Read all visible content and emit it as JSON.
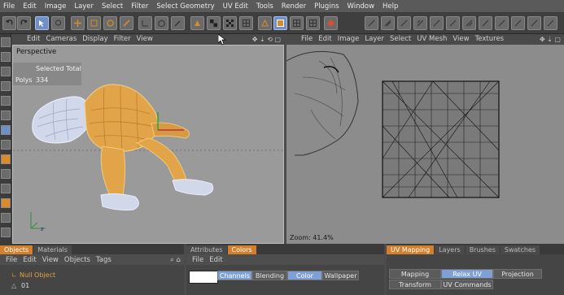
{
  "menubar": [
    "File",
    "Edit",
    "Image",
    "Layer",
    "Select",
    "Filter",
    "Select Geometry",
    "UV Edit",
    "Tools",
    "Render",
    "Plugins",
    "Window",
    "Help"
  ],
  "viewport": {
    "menu": [
      "Edit",
      "Cameras",
      "Display",
      "Filter",
      "View"
    ],
    "label": "Perspective",
    "hud_header": "Selected Total",
    "hud_row_label": "Polys",
    "hud_row_value": "334",
    "axis_z": "z"
  },
  "uv": {
    "menu": [
      "File",
      "Edit",
      "Image",
      "Layer",
      "Select",
      "UV Mesh",
      "View",
      "Textures"
    ],
    "zoom": "Zoom: 41.4%"
  },
  "objects": {
    "tabs": [
      "Objects",
      "Materials"
    ],
    "menu": [
      "File",
      "Edit",
      "View",
      "Objects",
      "Tags"
    ],
    "items": [
      {
        "name": "Null Object"
      },
      {
        "name": "01"
      }
    ]
  },
  "attributes": {
    "tabs": [
      "Attributes",
      "Colors"
    ],
    "menu": [
      "File",
      "Edit"
    ],
    "buttons": [
      "Channels",
      "Blending",
      "Color",
      "Wallpaper"
    ]
  },
  "uvmapping": {
    "tabs": [
      "UV Mapping",
      "Layers",
      "Brushes",
      "Swatches"
    ],
    "row1": [
      "Mapping",
      "Relax UV",
      "Projection"
    ],
    "row2": [
      "Transform",
      "UV Commands"
    ]
  },
  "colors": {
    "accent_orange": "#d3802e",
    "selected_blue": "#6f90c6",
    "mesh_orange": "#e8a848",
    "mesh_white": "#d8e0f0"
  }
}
